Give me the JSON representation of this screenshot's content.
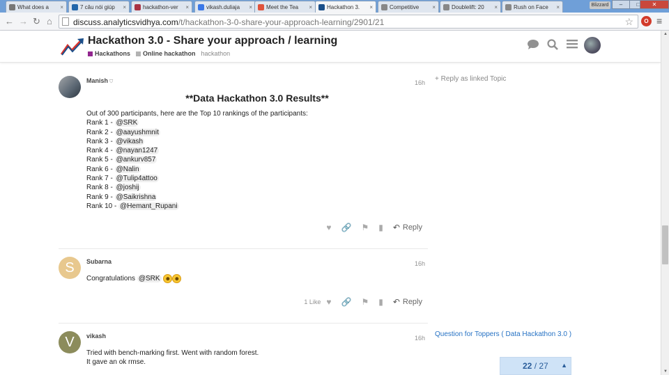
{
  "browser": {
    "tabs": [
      {
        "label": "What does a",
        "icon": "generic-page-icon",
        "color": "#777777"
      },
      {
        "label": "7 câu nói giúp",
        "icon": "hr-icon",
        "color": "#2266aa"
      },
      {
        "label": "hackathon-ver",
        "icon": "bookmark-icon",
        "color": "#aa3344"
      },
      {
        "label": "vikash.duliaja",
        "icon": "google-sites-icon",
        "color": "#3b78e7"
      },
      {
        "label": "Meet the Tea",
        "icon": "b-icon",
        "color": "#e0533c"
      },
      {
        "label": "Hackathon 3.",
        "icon": "av-logo-icon",
        "color": "#1b4f8a"
      },
      {
        "label": "Competitive",
        "icon": "reddit-icon",
        "color": "#888888"
      },
      {
        "label": "Doublelift: 20",
        "icon": "reddit-icon",
        "color": "#888888"
      },
      {
        "label": "Rush on Face",
        "icon": "reddit-icon",
        "color": "#888888"
      }
    ],
    "tab_close": "×",
    "user_chip": "Blizzard",
    "window_controls": {
      "minimize": "–",
      "maximize": "□",
      "close": "✕"
    },
    "url_host": "discuss.analyticsvidhya.com",
    "url_path": "/t/hackathon-3-0-share-your-approach-learning/2901/21",
    "ext_badge": "O"
  },
  "header": {
    "title": "Hackathon 3.0 - Share your approach / learning",
    "categories": [
      {
        "name": "Hackathons",
        "color": "#92278f"
      },
      {
        "name": "Online hackathon",
        "color": "#b3b3b3"
      }
    ],
    "tag": "hackathon"
  },
  "posts": [
    {
      "username": "Manish",
      "badge": "⛉",
      "date": "16h",
      "heading": "**Data Hackathon 3.0 Results**",
      "intro": "Out of 300 participants, here are the Top 10 rankings of the participants:",
      "ranks": [
        {
          "label": "Rank 1 - ",
          "mention": "@SRK"
        },
        {
          "label": "Rank 2 - ",
          "mention": "@aayushmnit"
        },
        {
          "label": "Rank 3 - ",
          "mention": "@vikash"
        },
        {
          "label": "Rank 4 - ",
          "mention": "@nayan1247"
        },
        {
          "label": "Rank 5 - ",
          "mention": "@ankurv857"
        },
        {
          "label": "Rank 6 - ",
          "mention": "@Nalin"
        },
        {
          "label": "Rank 7 - ",
          "mention": "@Tulip4attoo"
        },
        {
          "label": "Rank 8 - ",
          "mention": "@joshij"
        },
        {
          "label": "Rank 9 - ",
          "mention": "@Saikrishna"
        },
        {
          "label": "Rank 10 - ",
          "mention": "@Hemant_Rupani"
        }
      ],
      "reply_label": "Reply",
      "side_link": "Reply as linked Topic"
    },
    {
      "username": "Subarna",
      "avatar_letter": "S",
      "avatar_color": "#e8c88e",
      "date": "16h",
      "text": "Congratulations ",
      "mention": "@SRK",
      "like_count": "1 Like",
      "reply_label": "Reply"
    },
    {
      "username": "vikash",
      "avatar_letter": "V",
      "avatar_color": "#8c8c5c",
      "date": "16h",
      "line1": "Tried with bench-marking first. Went with random forest.",
      "line2": "It gave an ok rmse.",
      "side_link": "Question for Toppers ( Data Hackathon 3.0 )"
    }
  ],
  "progress": {
    "current": "22",
    "separator": " / ",
    "total": "27"
  },
  "icons": {
    "back": "back-arrow-icon",
    "forward": "forward-arrow-icon",
    "reload": "reload-icon",
    "home": "home-icon",
    "star": "bookmark-star-icon",
    "chat": "chat-bubble-icon",
    "search": "search-icon",
    "menu": "hamburger-menu-icon"
  }
}
